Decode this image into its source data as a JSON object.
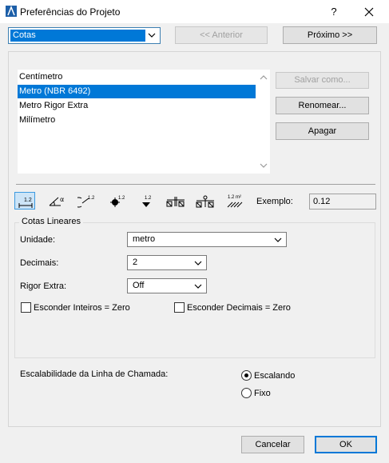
{
  "window": {
    "title": "Preferências do Projeto",
    "help": "?"
  },
  "top": {
    "page_select": "Cotas",
    "prev_label": "<< Anterior",
    "next_label": "Próximo >>"
  },
  "styles": {
    "items": [
      "Centímetro",
      "Metro (NBR 6492)",
      "Metro Rigor Extra",
      "Milímetro"
    ],
    "selected_index": 1
  },
  "side_buttons": {
    "save_as": "Salvar como...",
    "rename": "Renomear...",
    "delete": "Apagar"
  },
  "dimension_types": {
    "icons": [
      "linear-dimension-icon",
      "angular-dimension-icon",
      "radial-dimension-icon",
      "level-dimension-icon",
      "elevation-dimension-icon",
      "door-window-dimension-icon",
      "sill-height-dimension-icon",
      "area-dimension-icon"
    ],
    "icon_labels": [
      "1.2",
      "α",
      "1.2",
      "1.2",
      "1.2",
      "",
      "",
      "1.2 m²"
    ],
    "example_label": "Exemplo:",
    "example_value": "0.12"
  },
  "linear": {
    "group_title": "Cotas Lineares",
    "unit_label": "Unidade:",
    "unit_value": "metro",
    "decimals_label": "Decimais:",
    "decimals_value": "2",
    "extra_label": "Rigor Extra:",
    "extra_value": "Off",
    "hide_int_label": "Esconder Inteiros = Zero",
    "hide_dec_label": "Esconder Decimais = Zero"
  },
  "leader": {
    "label": "Escalabilidade da Linha de Chamada:",
    "opt_scaling": "Escalando",
    "opt_fixed": "Fixo",
    "selected": "Escalando"
  },
  "footer": {
    "cancel": "Cancelar",
    "ok": "OK"
  },
  "colors": {
    "accent": "#0078d7",
    "panel": "#f0f0f0"
  }
}
